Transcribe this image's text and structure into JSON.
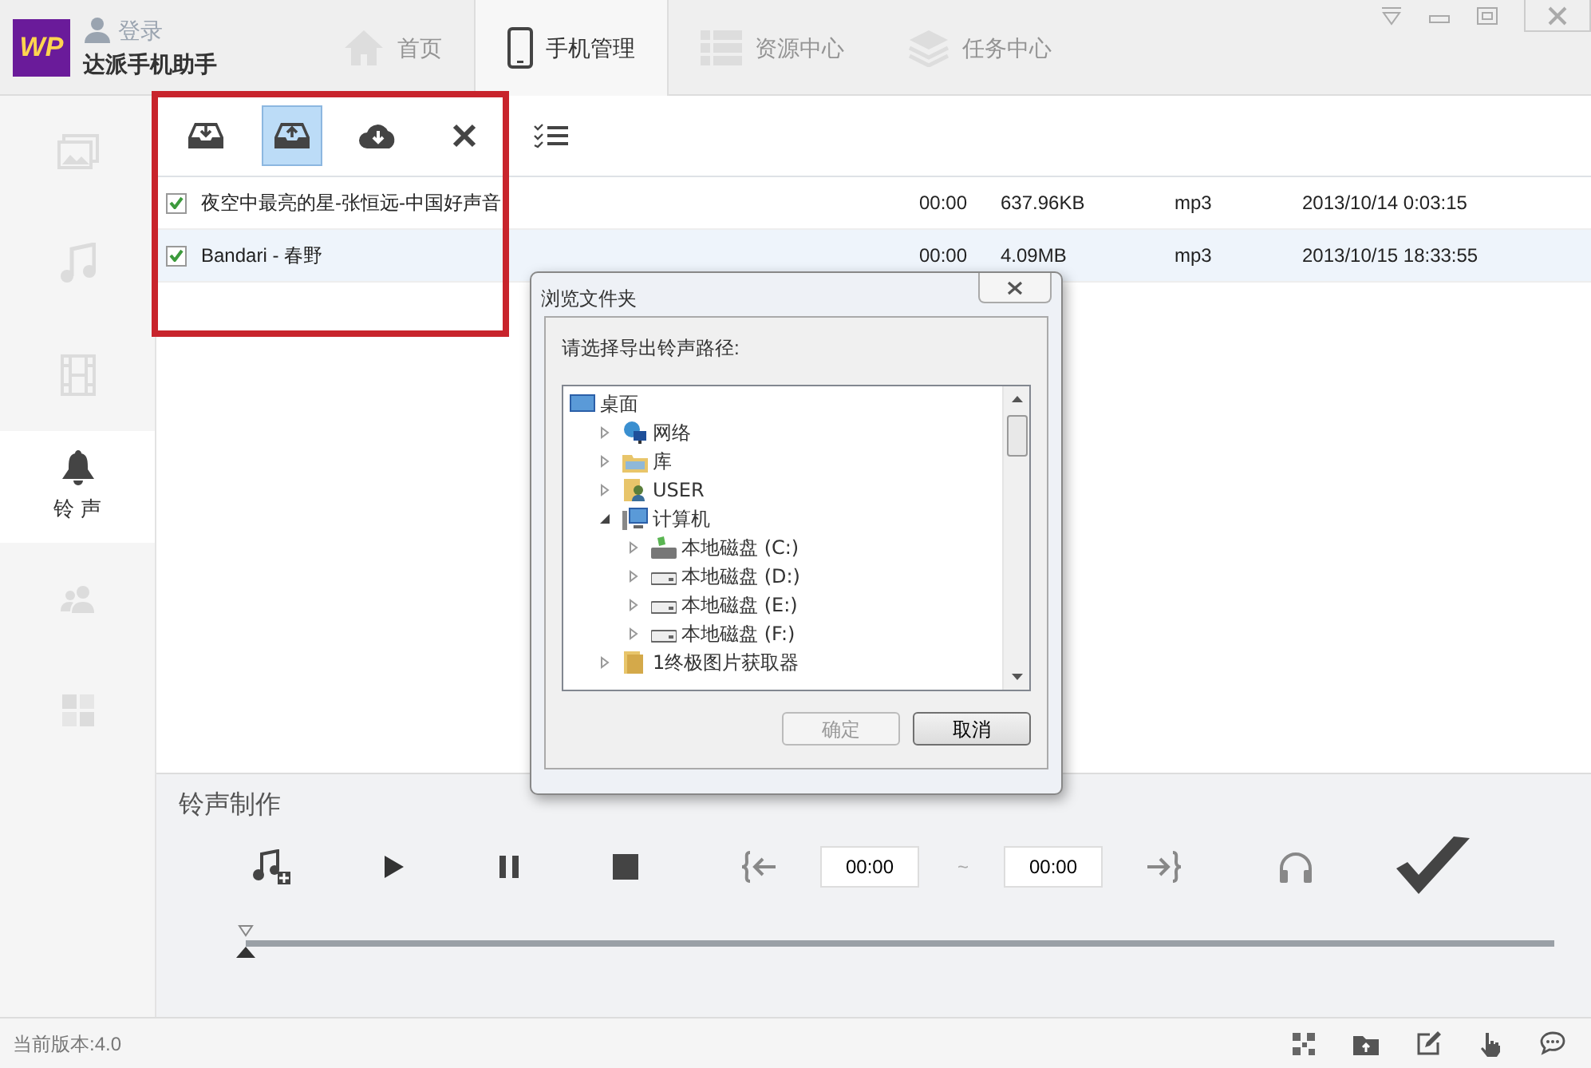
{
  "app": {
    "logo_text": "WP",
    "login": "登录",
    "name": "达派手机助手"
  },
  "nav_tabs": [
    {
      "kind": "home",
      "label": "首页",
      "selected": false
    },
    {
      "kind": "phone",
      "label": "手机管理",
      "selected": true
    },
    {
      "kind": "resources",
      "label": "资源中心",
      "selected": false
    },
    {
      "kind": "tasks",
      "label": "任务中心",
      "selected": false
    }
  ],
  "sidebar": {
    "items": [
      {
        "kind": "photos",
        "selected": false
      },
      {
        "kind": "music",
        "selected": false
      },
      {
        "kind": "video",
        "selected": false
      },
      {
        "kind": "ringtones",
        "label": "铃 声",
        "selected": true
      },
      {
        "kind": "contacts",
        "selected": false
      },
      {
        "kind": "apps",
        "selected": false
      }
    ]
  },
  "toolbar": [
    {
      "kind": "import",
      "selected": false
    },
    {
      "kind": "export",
      "selected": true
    },
    {
      "kind": "cloud",
      "selected": false
    },
    {
      "kind": "delete",
      "selected": false
    },
    {
      "kind": "select-all",
      "selected": false
    }
  ],
  "files": [
    {
      "checked": true,
      "selected": false,
      "name": "夜空中最亮的星-张恒远-中国好声音",
      "duration": "00:00",
      "size": "637.96KB",
      "format": "mp3",
      "date": "2013/10/14 0:03:15"
    },
    {
      "checked": true,
      "selected": true,
      "name": "Bandari - 春野",
      "duration": "00:00",
      "size": "4.09MB",
      "format": "mp3",
      "date": "2013/10/15 18:33:55"
    }
  ],
  "ringtone_maker": {
    "title": "铃声制作",
    "start_time": "00:00",
    "separator": "~",
    "end_time": "00:00",
    "level": 0
  },
  "dialog": {
    "title": "浏览文件夹",
    "prompt": "请选择导出铃声路径:",
    "tree": [
      {
        "kind": "desktop",
        "label": "桌面",
        "children": [
          {
            "kind": "network",
            "label": "网络",
            "expanded": false
          },
          {
            "kind": "library",
            "label": "库",
            "expanded": false
          },
          {
            "kind": "user",
            "label": "USER",
            "expanded": false
          },
          {
            "kind": "computer",
            "label": "计算机",
            "expanded": true,
            "children": [
              {
                "kind": "system-drive",
                "label": "本地磁盘 (C:)",
                "expanded": false
              },
              {
                "kind": "drive",
                "label": "本地磁盘 (D:)",
                "expanded": false
              },
              {
                "kind": "drive",
                "label": "本地磁盘 (E:)",
                "expanded": false
              },
              {
                "kind": "drive",
                "label": "本地磁盘 (F:)",
                "expanded": false
              }
            ]
          },
          {
            "kind": "folder",
            "label": "1终极图片获取器",
            "expanded": false
          }
        ]
      }
    ],
    "buttons": [
      {
        "label": "确定",
        "disabled": true
      },
      {
        "label": "取消",
        "disabled": false
      }
    ]
  },
  "status_bar": {
    "version": "当前版本:4.0"
  }
}
